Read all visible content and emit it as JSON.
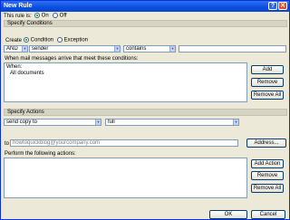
{
  "window": {
    "title": "New Rule",
    "help_glyph": "?",
    "close_glyph": "✕"
  },
  "rule_toggle": {
    "label": "This rule is:",
    "on": "On",
    "off": "Off"
  },
  "conditions": {
    "header": "Specify Conditions",
    "create_label": "Create",
    "condition_option": "Condition",
    "exception_option": "Exception",
    "logic_value": "AND",
    "field_value": "sender",
    "operator_value": "contains",
    "match_value": "",
    "list_label": "When mail messages arrive that meet these conditions:",
    "list_lines": [
      "When:",
      "All documents"
    ],
    "add_button": "Add",
    "remove_button": "Remove",
    "remove_all_button": "Remove All"
  },
  "actions": {
    "header": "Specify Actions",
    "action_value": "send copy to",
    "mode_value": "full",
    "to_label": "to",
    "to_value": "howtoquickblog@yourcompany.com",
    "address_button": "Address...",
    "list_label": "Perform the following actions:",
    "add_action_button": "Add Action",
    "remove_button": "Remove",
    "remove_all_button": "Remove All"
  },
  "footer": {
    "ok_button": "OK",
    "cancel_button": "Cancel"
  }
}
